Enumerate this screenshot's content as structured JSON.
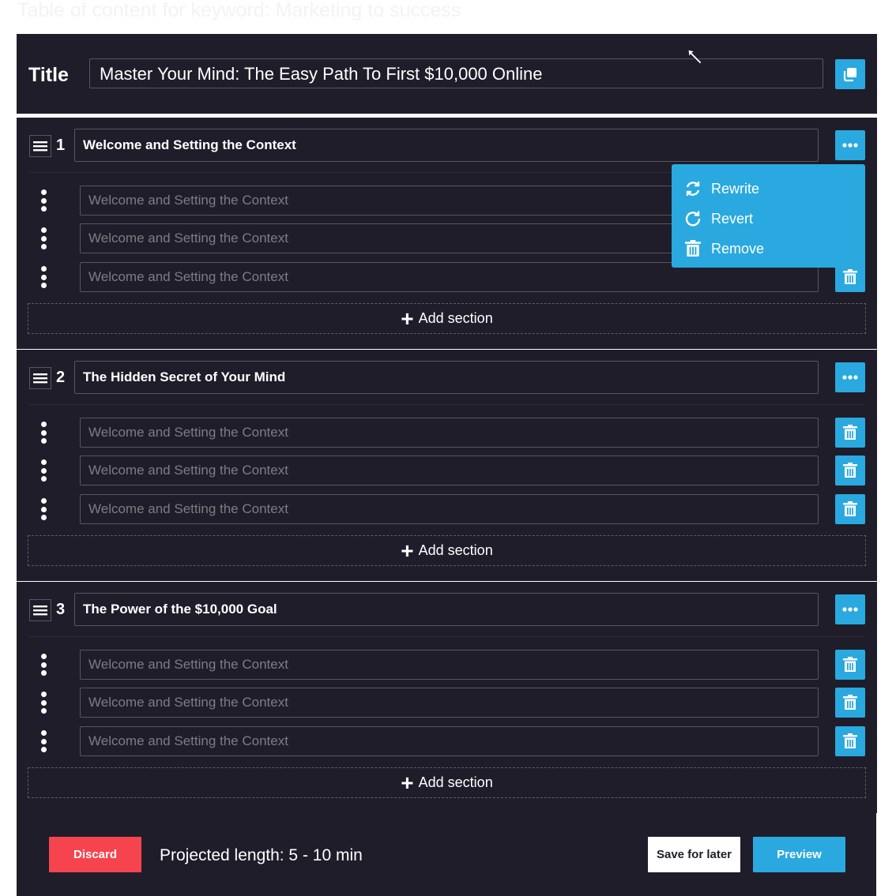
{
  "page": {
    "heading": "Table of content for keyword: Marketing to success"
  },
  "title_section": {
    "label": "Title",
    "value": "Master Your Mind: The Easy Path To First $10,000 Online",
    "copy_icon": "copy-icon"
  },
  "chapters": [
    {
      "number": "1",
      "title": "Welcome and Setting the Context",
      "sections": [
        "Welcome and Setting the Context",
        "Welcome and Setting the Context",
        "Welcome and Setting the Context"
      ],
      "add_section_label": "Add section"
    },
    {
      "number": "2",
      "title": "The Hidden Secret of Your Mind",
      "sections": [
        "Welcome and Setting the Context",
        "Welcome and Setting the Context",
        "Welcome and Setting the Context"
      ],
      "add_section_label": "Add section"
    },
    {
      "number": "3",
      "title": "The Power of the $10,000 Goal",
      "sections": [
        "Welcome and Setting the Context",
        "Welcome and Setting the Context",
        "Welcome and Setting the Context"
      ],
      "add_section_label": "Add section"
    }
  ],
  "dropdown_menu": {
    "items": [
      {
        "label": "Rewrite",
        "icon": "rewrite-icon"
      },
      {
        "label": "Revert",
        "icon": "revert-icon"
      },
      {
        "label": "Remove",
        "icon": "trash-icon"
      }
    ]
  },
  "footer": {
    "discard_label": "Discard",
    "projected_length": "Projected length: 5 - 10 min",
    "save_label": "Save for later",
    "preview_label": "Preview"
  },
  "colors": {
    "panel_bg": "#1f1d29",
    "accent_blue": "#29a9df",
    "danger_red": "#f6444e",
    "placeholder_text": "#7d7b85",
    "input_border": "#57555f"
  }
}
